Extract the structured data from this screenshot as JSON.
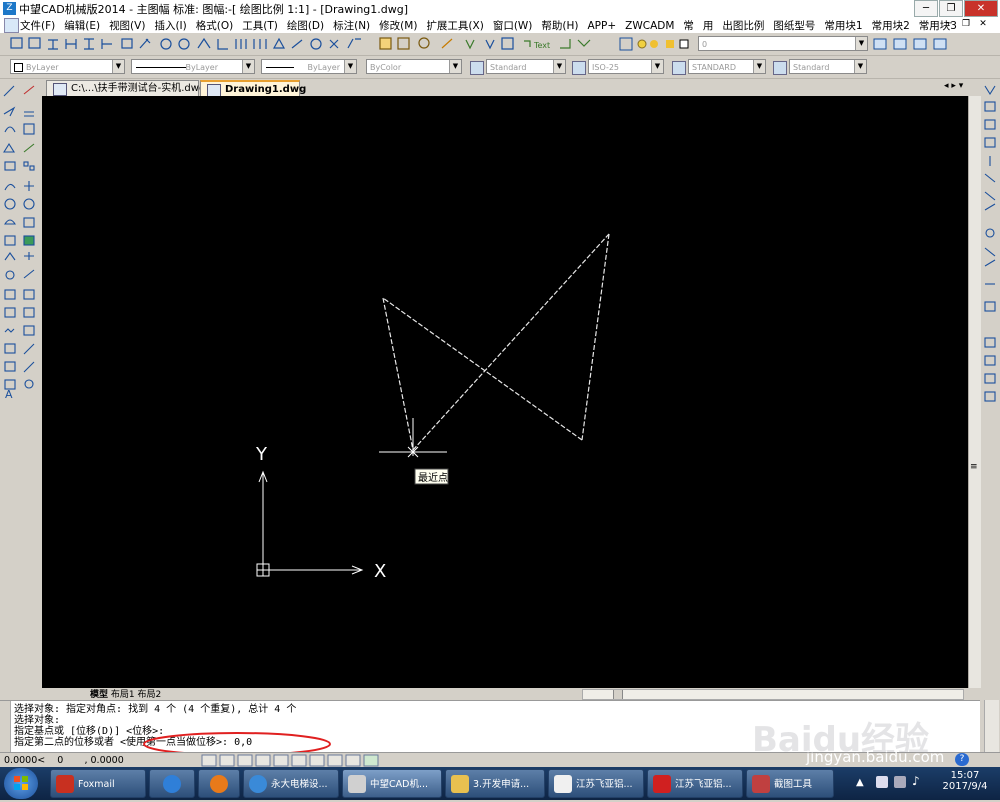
{
  "window": {
    "title": "中望CAD机械版2014 - 主图幅  标准: 图幅:-[ 绘图比例 1:1] - [Drawing1.dwg]",
    "logo": "Z"
  },
  "menu": [
    "文件(F)",
    "编辑(E)",
    "视图(V)",
    "插入(I)",
    "格式(O)",
    "工具(T)",
    "绘图(D)",
    "标注(N)",
    "修改(M)",
    "扩展工具(X)",
    "窗口(W)",
    "帮助(H)",
    "APP+",
    "ZWCADM",
    "常",
    "用",
    "出图比例",
    "图纸型号",
    "常用块1",
    "常用块2",
    "常用块3"
  ],
  "properties": {
    "color": "ByLayer",
    "linetype": "ByLayer",
    "lineweight": "ByLayer",
    "plotstyle": "ByColor",
    "textstyle": "Standard",
    "dimstyle": "ISO-25",
    "tablestyle": "STANDARD",
    "mleaderstyle": "Standard",
    "layer": "0",
    "text_tool": "Text"
  },
  "tabs": [
    {
      "label": "C:\\...\\扶手带测试台-实机.dwg",
      "active": false
    },
    {
      "label": "Drawing1.dwg",
      "active": true
    }
  ],
  "canvas": {
    "tooltip": "最近点",
    "ucs_x": "X",
    "ucs_y": "Y"
  },
  "layout_tabs": [
    "模型",
    "布局1",
    "布局2"
  ],
  "command_lines": [
    "选择对象: 指定对角点: 找到 4 个 (4 个重复), 总计 4 个",
    "选择对象:",
    "指定基点或 [位移(D)] <位移>:",
    "指定第二点的位移或者 <使用第一点当做位移>: 0,0"
  ],
  "status": {
    "coords": "0.0000<    0       , 0.0000"
  },
  "taskbar": {
    "buttons": [
      {
        "label": "Foxmail",
        "color": "#c83020"
      },
      {
        "label": "",
        "color": "#2f7fd8"
      },
      {
        "label": "",
        "color": "#e87a1a"
      },
      {
        "label": "永大电梯设...",
        "color": "#3a8ad8"
      },
      {
        "label": "中望CAD机...",
        "color": "#d0d0d0"
      },
      {
        "label": "3.开发申请...",
        "color": "#e8c050"
      },
      {
        "label": "江苏飞亚铝...",
        "color": "#f0f0f0"
      },
      {
        "label": "江苏飞亚铝...",
        "color": "#d02020"
      },
      {
        "label": "截图工具",
        "color": "#c04040"
      }
    ],
    "time": "15:07",
    "date": "2017/9/4"
  },
  "watermark": {
    "text": "Baidu经验",
    "url": "jingyan.baidu.com"
  },
  "colors": {
    "canvas": "#000000",
    "highlight_ellipse": "#e02020",
    "taskbar": "#12294a"
  }
}
